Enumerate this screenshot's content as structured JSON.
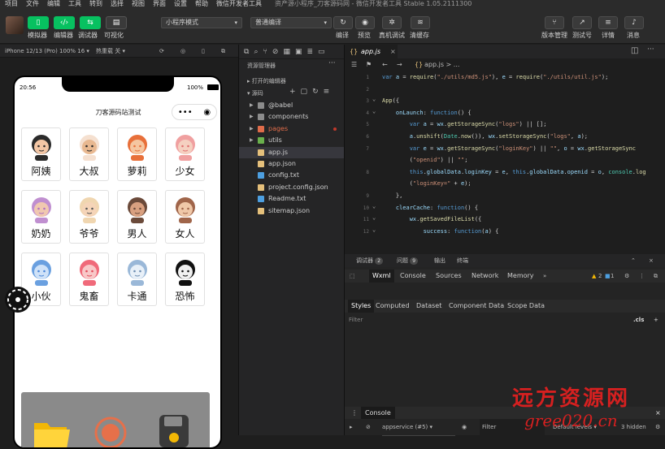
{
  "menubar": {
    "items": [
      "项目",
      "文件",
      "编辑",
      "工具",
      "转到",
      "选择",
      "视图",
      "界面",
      "设置",
      "帮助",
      "微信开发者工具"
    ],
    "window_title": "资产源小程序_刀客源码网 - 微信开发者工具 Stable 1.05.2111300"
  },
  "toolbar": {
    "left_buttons": [
      {
        "label": "模拟器",
        "icon": "phone-icon"
      },
      {
        "label": "编辑器",
        "icon": "code-icon"
      },
      {
        "label": "调试器",
        "icon": "debug-icon"
      },
      {
        "label": "可视化",
        "icon": "layout-icon"
      }
    ],
    "mode_select": "小程序模式",
    "compile_select": "普通编译",
    "center_buttons": [
      {
        "label": "编译",
        "icon": "refresh-icon"
      },
      {
        "label": "预览",
        "icon": "eye-icon"
      },
      {
        "label": "真机调试",
        "icon": "bug-icon"
      },
      {
        "label": "清缓存",
        "icon": "layers-icon"
      }
    ],
    "right_buttons": [
      {
        "label": "版本管理",
        "icon": "branch-icon"
      },
      {
        "label": "测试号",
        "icon": "external-icon"
      },
      {
        "label": "详情",
        "icon": "menu-icon"
      },
      {
        "label": "消息",
        "icon": "bell-icon"
      }
    ],
    "green": "#07c160"
  },
  "simulator": {
    "device": "iPhone 12/13 (Pro) 100% 16 ▾",
    "hotreload": "热重载 关 ▾",
    "time": "20:56",
    "battery": "100%",
    "nav_title": "刀客源码站测试",
    "capsule_dots": "•••",
    "items": [
      {
        "name": "阿姨",
        "icon": "auntie-avatar-icon"
      },
      {
        "name": "大叔",
        "icon": "uncle-avatar-icon"
      },
      {
        "name": "萝莉",
        "icon": "girl-avatar-icon"
      },
      {
        "name": "少女",
        "icon": "young-woman-avatar-icon"
      },
      {
        "name": "奶奶",
        "icon": "grandma-avatar-icon"
      },
      {
        "name": "爷爷",
        "icon": "grandpa-avatar-icon"
      },
      {
        "name": "男人",
        "icon": "man-avatar-icon"
      },
      {
        "name": "女人",
        "icon": "woman-avatar-icon"
      },
      {
        "name": "小伙",
        "icon": "young-man-avatar-icon"
      },
      {
        "name": "鬼畜",
        "icon": "clown-avatar-icon"
      },
      {
        "name": "卡通",
        "icon": "cat-avatar-icon"
      },
      {
        "name": "恐怖",
        "icon": "scream-avatar-icon"
      }
    ]
  },
  "explorer": {
    "title": "资源管理器",
    "open_editors": "打开的编辑器",
    "root": "源码",
    "tree": [
      {
        "label": "@babel",
        "type": "folder",
        "color": "#8c8c8c"
      },
      {
        "label": "components",
        "type": "folder",
        "color": "#8c8c8c"
      },
      {
        "label": "pages",
        "type": "folder",
        "color": "#e06c4a",
        "modified": true
      },
      {
        "label": "utils",
        "type": "folder",
        "color": "#6ab04c"
      },
      {
        "label": "app.js",
        "type": "file",
        "color": "#e5c07b",
        "selected": true
      },
      {
        "label": "app.json",
        "type": "file",
        "color": "#e5c07b"
      },
      {
        "label": "config.txt",
        "type": "file",
        "color": "#4d9fe0"
      },
      {
        "label": "project.config.json",
        "type": "file",
        "color": "#e5c07b"
      },
      {
        "label": "Readme.txt",
        "type": "file",
        "color": "#4d9fe0"
      },
      {
        "label": "sitemap.json",
        "type": "file",
        "color": "#e5c07b"
      }
    ]
  },
  "editor": {
    "tab": "app.js",
    "breadcrumb": "app.js > ...",
    "lines": [
      {
        "num": "1",
        "text": "var a = require(\"./utils/md5.js\"), e = require(\"./utils/util.js\");"
      },
      {
        "num": "2",
        "text": ""
      },
      {
        "num": "3",
        "text": "App({"
      },
      {
        "num": "4",
        "text": "    onLaunch: function() {"
      },
      {
        "num": "5",
        "text": "        var a = wx.getStorageSync(\"logs\") || [];"
      },
      {
        "num": "6",
        "text": "        a.unshift(Date.now()), wx.setStorageSync(\"logs\", a);"
      },
      {
        "num": "7",
        "text": "        var e = wx.getStorageSync(\"loginKey\") || \"\", o = wx.getStorageSync"
      },
      {
        "num": "",
        "text": "        (\"openid\") || \"\";"
      },
      {
        "num": "8",
        "text": "        this.globalData.loginKey = e, this.globalData.openid = o, console.log"
      },
      {
        "num": "",
        "text": "        (\"loginKey=\" + e);"
      },
      {
        "num": "9",
        "text": "    },"
      },
      {
        "num": "10",
        "text": "    clearCache: function() {"
      },
      {
        "num": "11",
        "text": "        wx.getSavedFileList({"
      },
      {
        "num": "12",
        "text": "            success: function(a) {"
      }
    ]
  },
  "debugger": {
    "tabs": [
      {
        "label": "调试器",
        "badge": "2"
      },
      {
        "label": "问题",
        "badge": "9"
      },
      {
        "label": "输出",
        "badge": ""
      },
      {
        "label": "终端",
        "badge": ""
      }
    ],
    "devtools_tabs": [
      "Wxml",
      "Console",
      "Sources",
      "Network",
      "Memory"
    ],
    "warnings": "2",
    "errors": "1",
    "style_tabs": [
      "Styles",
      "Computed",
      "Dataset",
      "Component Data",
      "Scope Data"
    ],
    "filter_placeholder": "Filter",
    "cls_label": ".cls",
    "plus_label": "+",
    "console_label": "Console",
    "context": "appservice (#5)",
    "console_filter": "Filter",
    "levels": "Default levels",
    "hidden": "3 hidden"
  },
  "watermark": {
    "line1": "远方资源网",
    "line2": "gree020.cn"
  }
}
